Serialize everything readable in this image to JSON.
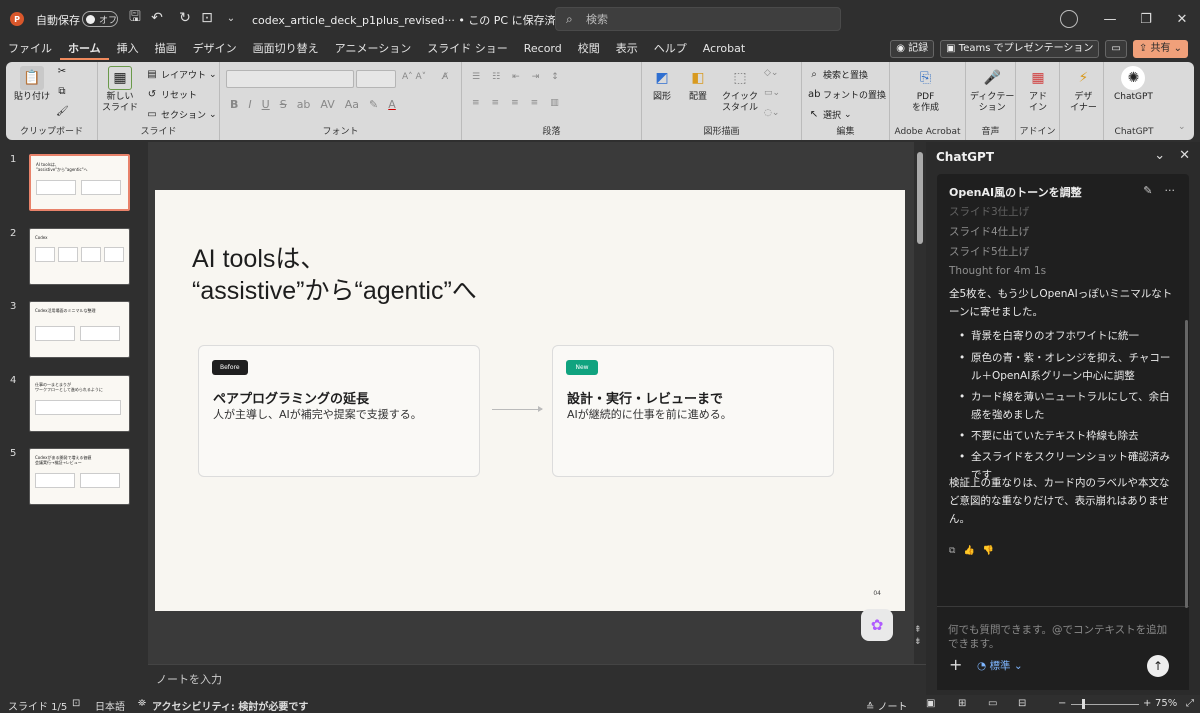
{
  "titlebar": {
    "autosave_label": "自動保存",
    "autosave_state": "オフ",
    "doc_title": "codex_article_deck_p1plus_revised··· • この PC に保存済み ⌄",
    "search_placeholder": "検索"
  },
  "ribbon_tabs": [
    "ファイル",
    "ホーム",
    "挿入",
    "描画",
    "デザイン",
    "画面切り替え",
    "アニメーション",
    "スライド ショー",
    "Record",
    "校閲",
    "表示",
    "ヘルプ",
    "Acrobat"
  ],
  "ribbon_right": {
    "record": "記録",
    "teams": "Teams でプレゼンテーション",
    "share": "共有"
  },
  "ribbon": {
    "clipboard": {
      "paste": "貼り付け",
      "label": "クリップボード"
    },
    "slides": {
      "new_slide": "新しい\nスライド",
      "layout": "レイアウト",
      "reset": "リセット",
      "section": "セクション",
      "label": "スライド"
    },
    "font": {
      "label": "フォント",
      "bold": "B",
      "italic": "I",
      "underline": "U",
      "strike": "S",
      "shadow": "ab",
      "spacing": "AV",
      "case": "Aa",
      "color": "A"
    },
    "paragraph": {
      "label": "段落"
    },
    "drawing": {
      "shapes": "図形",
      "arrange": "配置",
      "quick_styles": "クイック\nスタイル",
      "label": "図形描画"
    },
    "editing": {
      "find_replace": "検索と置換",
      "font_replace": "フォントの置換",
      "select": "選択",
      "label": "編集"
    },
    "acrobat": {
      "pdf": "PDF\nを作成",
      "label": "Adobe Acrobat"
    },
    "voice": {
      "dictate": "ディクテー\nション",
      "label": "音声"
    },
    "addins": {
      "addins": "アド\nイン",
      "label": "アドイン"
    },
    "designer": {
      "designer": "デザ\nイナー"
    },
    "chatgpt": {
      "button": "ChatGPT",
      "label": "ChatGPT"
    }
  },
  "thumbnails": [
    {
      "num": "1",
      "title": "AI toolsは、\n\"assistive\"から\"agentic\"へ"
    },
    {
      "num": "2",
      "title": "Codex"
    },
    {
      "num": "3",
      "title": "Codex活用場面のミニマルな整理"
    },
    {
      "num": "4",
      "title": "仕事の一まとまりが\nワークフローとして進められるように"
    },
    {
      "num": "5",
      "title": "Codexがある開発で増える価値\n会議実行→検証→レビュー"
    }
  ],
  "slide": {
    "title_line1": "AI toolsは、",
    "title_line2": "“assistive”から“agentic”へ",
    "card_left": {
      "badge": "Before",
      "head": "ペアプログラミングの延長",
      "body": "人が主導し、AIが補完や提案で支援する。"
    },
    "card_right": {
      "badge": "New",
      "head": "設計・実行・レビューまで",
      "body": "AIが継続的に仕事を前に進める。"
    },
    "page_number": "04",
    "colors": {
      "before_badge": "#1f1f1f",
      "new_badge": "#10a37f"
    }
  },
  "notes_placeholder": "ノートを入力",
  "chat": {
    "header": "ChatGPT",
    "thread_title": "OpenAI風のトーンを調整",
    "faded": [
      "スライド3仕上げ",
      "スライド4仕上げ",
      "スライド5仕上げ",
      "Thought for 4m 1s"
    ],
    "intro": "全5枚を、もう少しOpenAIっぽいミニマルなトーンに寄せました。",
    "bullets": [
      "背景を白寄りのオフホワイトに統一",
      "原色の青・紫・オレンジを抑え、チャコール＋OpenAI系グリーン中心に調整",
      "カード線を薄いニュートラルにして、余白感を強めました",
      "不要に出ていたテキスト枠線も除去",
      "全スライドをスクリーンショット確認済みです"
    ],
    "outro": "検証上の重なりは、カード内のラベルや本文など意図的な重なりだけで、表示崩れはありません。",
    "input_placeholder": "何でも質問できます。@でコンテキストを追加できます。",
    "mode": "標準 ⌄"
  },
  "status": {
    "slide": "スライド 1/5",
    "language": "日本語",
    "accessibility": "アクセシビリティ: 検討が必要です",
    "notes": "ノート",
    "zoom": "75%"
  }
}
